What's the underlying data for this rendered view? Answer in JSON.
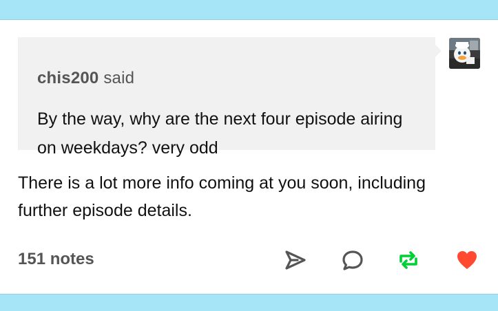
{
  "ask": {
    "asker": "chis200",
    "said_label": "said",
    "question": "By the way, why are the next four episode airing on weekdays? very odd"
  },
  "answer": {
    "text": "There is a lot more info coming at you soon, including further episode details."
  },
  "footer": {
    "notes": "151 notes",
    "icons": {
      "share": "paper-plane-icon",
      "reply": "speech-bubble-icon",
      "reblog": "reblog-icon",
      "like": "heart-icon"
    },
    "colors": {
      "share": "#555555",
      "reply": "#555555",
      "reblog": "#00cf35",
      "like": "#ff4930"
    }
  },
  "theme": {
    "band": "#a6e4f8",
    "ask_background": "#f1f1f1"
  }
}
